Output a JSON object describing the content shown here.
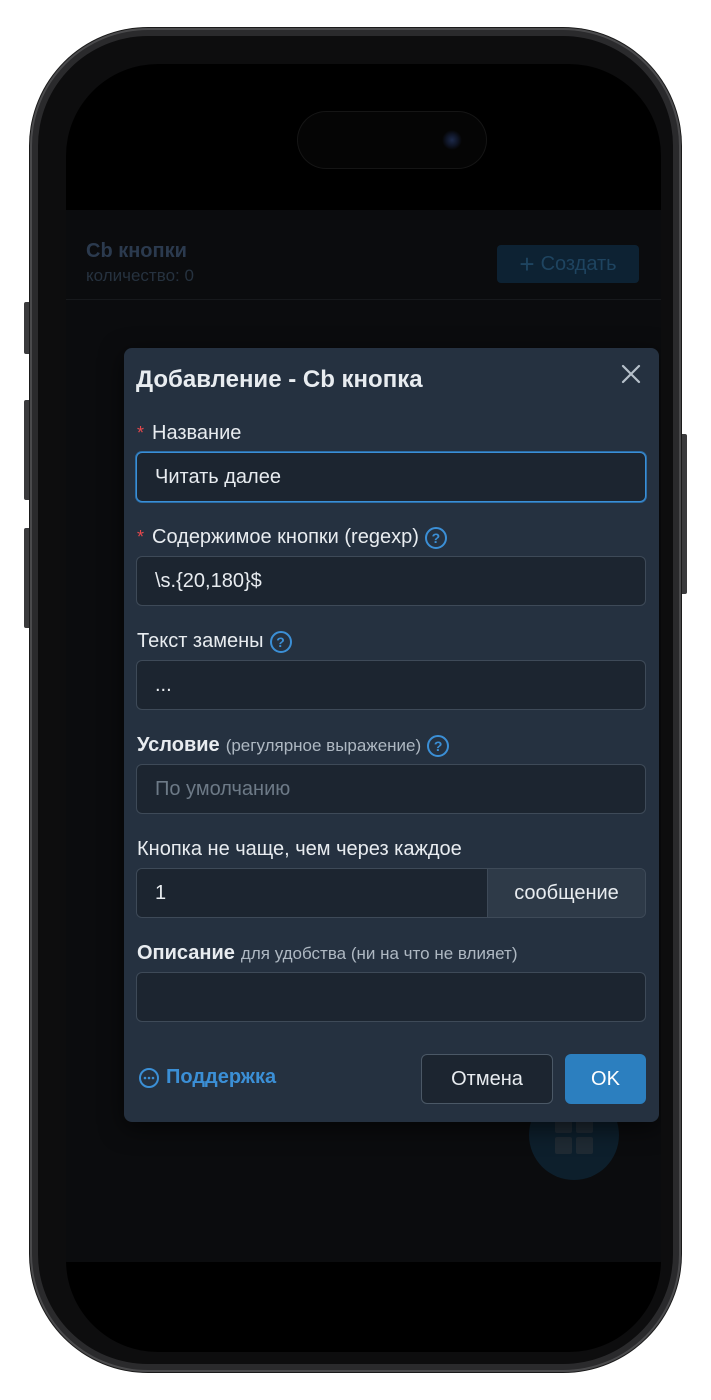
{
  "app": {
    "title": "Cb кнопки",
    "count_label": "количество: 0",
    "create_label": "Создать"
  },
  "modal": {
    "title": "Добавление - Cb кнопка",
    "fields": {
      "name": {
        "label": "Название",
        "required": true,
        "value": "Читать далее"
      },
      "content": {
        "label": "Содержимое кнопки (regexp)",
        "required": true,
        "value": "\\s.{20,180}$"
      },
      "replace": {
        "label": "Текст замены",
        "value": "..."
      },
      "condition": {
        "label": "Условие",
        "hint": "(регулярное выражение)",
        "placeholder": "По умолчанию",
        "value": ""
      },
      "frequency": {
        "label": "Кнопка не чаще, чем через каждое",
        "value": "1",
        "addon": "сообщение"
      },
      "description": {
        "label": "Описание",
        "hint": "для удобства (ни на что не влияет)",
        "value": ""
      }
    },
    "footer": {
      "support_label": "Поддержка",
      "cancel_label": "Отмена",
      "ok_label": "OK"
    }
  },
  "colors": {
    "accent": "#2c7fbf",
    "link": "#3b8fd6",
    "required": "#e5484d",
    "modal_bg": "#253140",
    "input_bg": "#1c2530"
  },
  "icons": {
    "close": "close-icon",
    "help": "help-circle-icon",
    "support": "chat-bubble-icon",
    "create": "plus-icon",
    "fab": "grid-icon"
  }
}
